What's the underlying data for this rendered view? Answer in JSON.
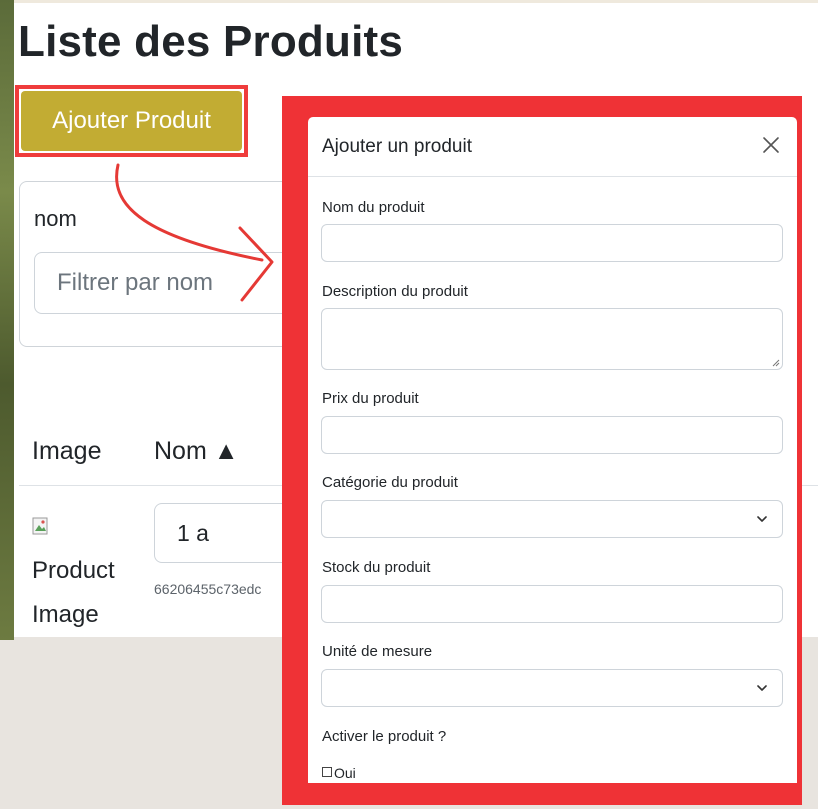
{
  "page": {
    "title": "Liste des Produits",
    "add_button_label": "Ajouter Produit"
  },
  "filter": {
    "label": "nom",
    "placeholder": "Filtrer par nom"
  },
  "table": {
    "headers": {
      "image": "Image",
      "nom": "Nom ▲"
    },
    "rows": [
      {
        "image_alt": "Product Image",
        "nom": "1 a",
        "id": "66206455c73edc"
      }
    ]
  },
  "modal": {
    "title": "Ajouter un produit",
    "fields": {
      "name_label": "Nom du produit",
      "description_label": "Description du produit",
      "price_label": "Prix du produit",
      "category_label": "Catégorie du produit",
      "stock_label": "Stock du produit",
      "unit_label": "Unité de mesure",
      "active_label": "Activer le produit ?",
      "active_option": "Oui"
    }
  },
  "colors": {
    "highlight": "#ef3236",
    "add_button": "#c2ac33"
  },
  "icons": {
    "close": "close-icon",
    "chevron": "chevron-down-icon",
    "broken_image": "broken-image-icon"
  }
}
